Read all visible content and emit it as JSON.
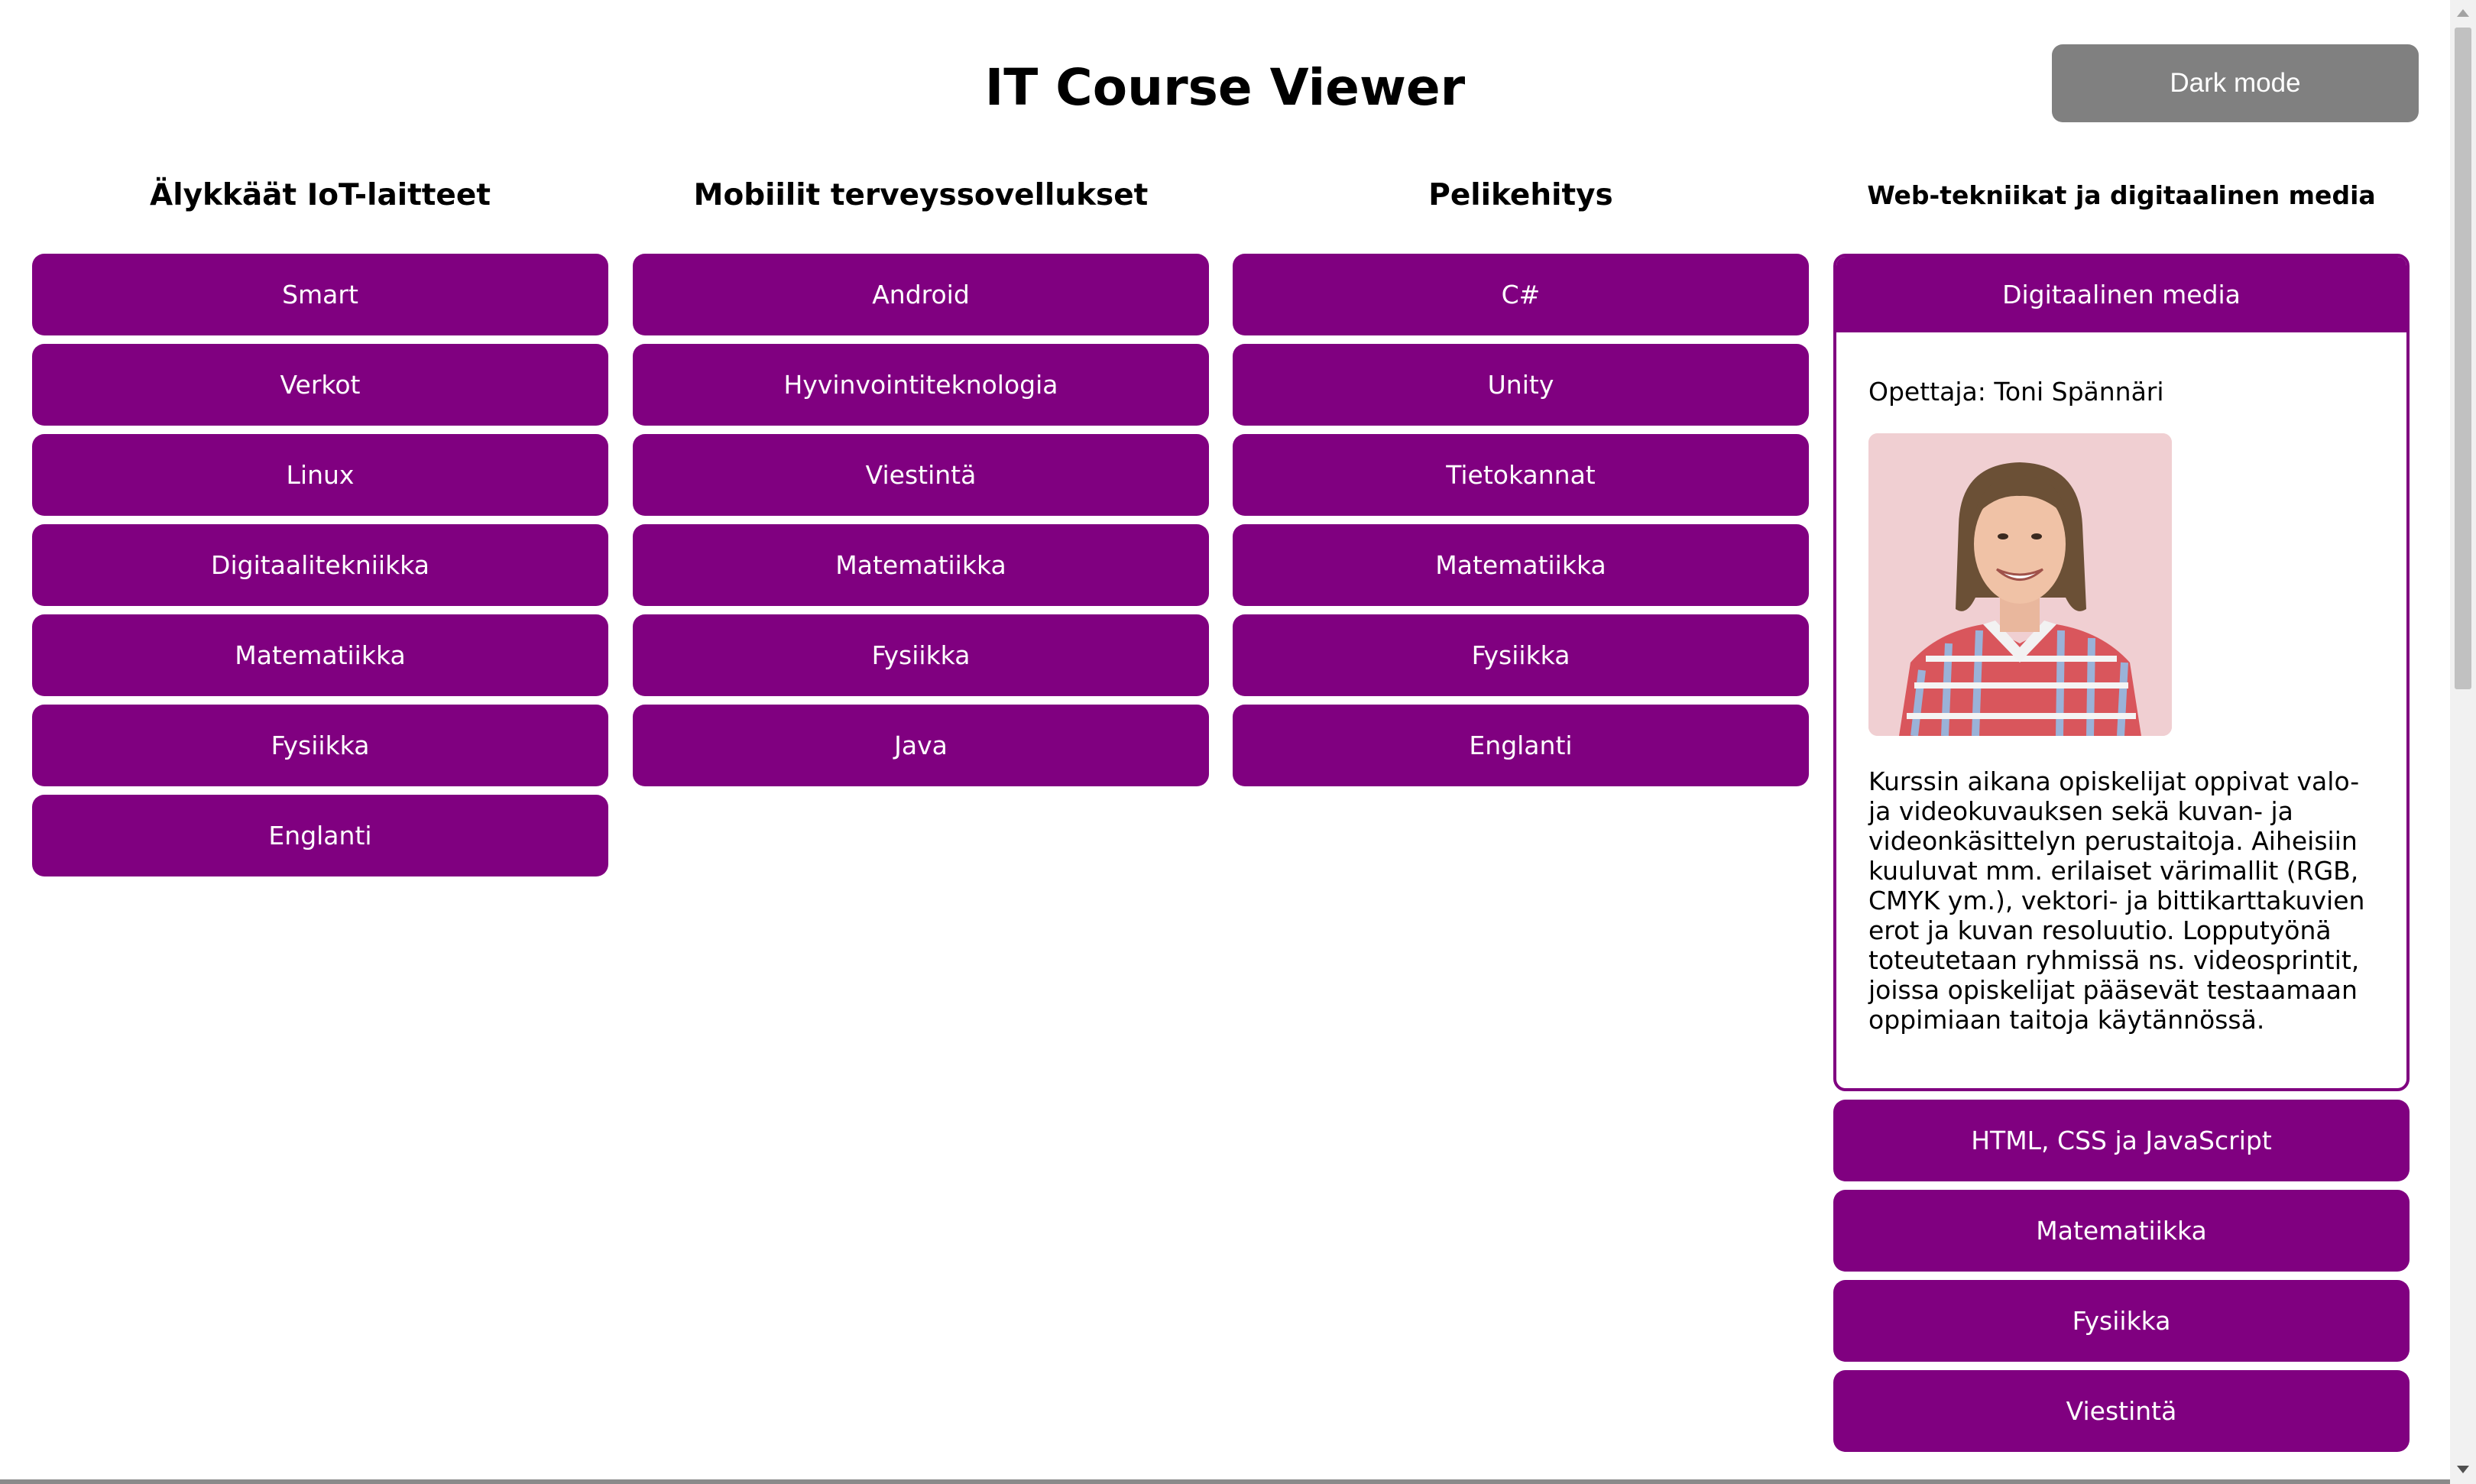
{
  "app": {
    "title": "IT Course Viewer",
    "dark_mode_label": "Dark mode"
  },
  "colors": {
    "accent": "#800080",
    "dark_mode_button": "#808080",
    "background": "#ffffff"
  },
  "columns": [
    {
      "heading": "Älykkäät IoT-laitteet",
      "courses": [
        "Smart",
        "Verkot",
        "Linux",
        "Digitaalitekniikka",
        "Matematiikka",
        "Fysiikka",
        "Englanti"
      ]
    },
    {
      "heading": "Mobiilit terveyssovellukset",
      "courses": [
        "Android",
        "Hyvinvointiteknologia",
        "Viestintä",
        "Matematiikka",
        "Fysiikka",
        "Java"
      ]
    },
    {
      "heading": "Pelikehitys",
      "courses": [
        "C#",
        "Unity",
        "Tietokannat",
        "Matematiikka",
        "Fysiikka",
        "Englanti"
      ]
    },
    {
      "heading": "Web-tekniikat ja digitaalinen media",
      "expanded_course": {
        "label": "Digitaalinen media",
        "teacher": "Opettaja: Toni Spännäri",
        "photo_icon": "teacher-photo",
        "description": "Kurssin aikana opiskelijat oppivat valo- ja videokuvauksen sekä kuvan- ja videonkäsittelyn perustaitoja. Aiheisiin kuuluvat mm. erilaiset värimallit (RGB, CMYK ym.), vektori- ja bittikarttakuvien erot ja kuvan resoluutio. Lopputyönä toteutetaan ryhmissä ns. videosprintit, joissa opiskelijat pääsevät testaamaan oppimiaan taitoja käytännössä."
      },
      "courses": [
        "HTML, CSS ja JavaScript",
        "Matematiikka",
        "Fysiikka",
        "Viestintä"
      ]
    }
  ]
}
